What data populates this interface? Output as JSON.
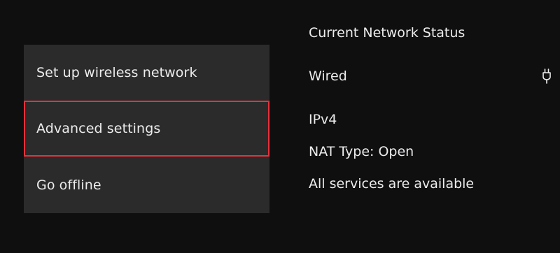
{
  "menu": {
    "items": [
      {
        "label": "Set up wireless network"
      },
      {
        "label": "Advanced settings"
      },
      {
        "label": "Go offline"
      }
    ]
  },
  "status": {
    "title": "Current Network Status",
    "connection": "Wired",
    "connection_icon": "ethernet-plug-icon",
    "ip_version": "IPv4",
    "nat_type": "NAT Type: Open",
    "services": "All services are available"
  },
  "colors": {
    "background": "#0f0f10",
    "menu_panel": "#2b2b2b",
    "text": "#ececec",
    "selection_outline": "#e8313a"
  }
}
